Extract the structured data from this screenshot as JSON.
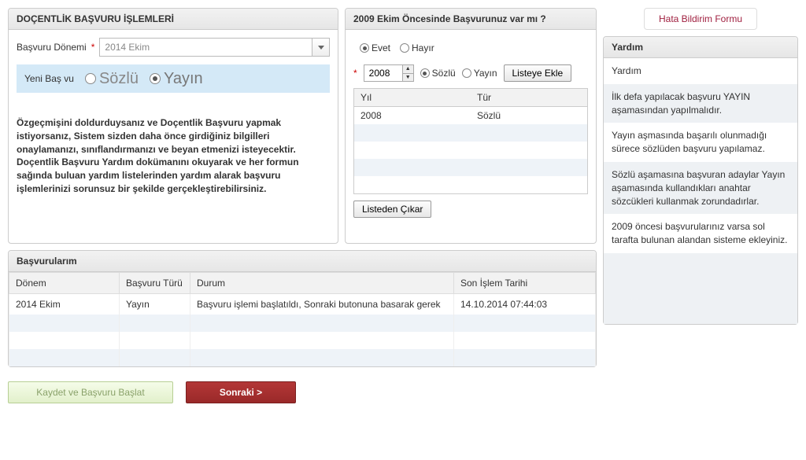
{
  "left_panel": {
    "title": "DOÇENTLİK BAŞVURU İŞLEMLERİ",
    "period_label": "Başvuru Dönemi",
    "period_value": "2014 Ekim",
    "new_app_label": "Yeni Baş vu",
    "radio_sozlu": "Sözlü",
    "radio_yayin": "Yayın",
    "info": "Özgeçmişini doldurduysanız ve Doçentlik Başvuru yapmak istiyorsanız, Sistem sizden daha önce girdiğiniz bilgilleri onaylamanızı, sınıflandırmanızı ve beyan etmenizi isteyecektir. Doçentlik Başvuru Yardım dokümanını okuyarak ve her formun sağında buluan yardım listelerinden yardım alarak başvuru işlemlerinizi sorunsuz bir şekilde gerçekleştirebilirsiniz."
  },
  "mid_panel": {
    "title": "2009 Ekim Öncesinde Başvurunuz var mı ?",
    "opt_yes": "Evet",
    "opt_no": "Hayır",
    "year_value": "2008",
    "opt_sozlu": "Sözlü",
    "opt_yayin": "Yayın",
    "btn_add": "Listeye Ekle",
    "col_year": "Yıl",
    "col_type": "Tür",
    "rows": [
      {
        "year": "2008",
        "type": "Sözlü"
      }
    ],
    "btn_remove": "Listeden Çıkar"
  },
  "apps_panel": {
    "title": "Başvurularım",
    "col_period": "Dönem",
    "col_type": "Başvuru Türü",
    "col_status": "Durum",
    "col_date": "Son İşlem Tarihi",
    "rows": [
      {
        "period": "2014 Ekim",
        "type": "Yayın",
        "status": "Başvuru işlemi başlatıldı, Sonraki butonuna basarak gerek",
        "date": "14.10.2014 07:44:03"
      }
    ]
  },
  "actions": {
    "save": "Kaydet ve Başvuru Başlat",
    "next": "Sonraki >"
  },
  "right": {
    "report_btn": "Hata Bildirim Formu",
    "help_title": "Yardım",
    "help_items": [
      "Yardım",
      "İlk defa yapılacak başvuru YAYIN aşamasından yapılmalıdır.",
      "Yayın aşmasında başarılı olunmadığı sürece sözlüden başvuru yapılamaz.",
      "Sözlü aşamasına başvuran adaylar Yayın aşamasında kullandıkları anahtar sözcükleri kullanmak zorundadırlar.",
      "2009 öncesi başvurularınız varsa sol tarafta bulunan alandan sisteme ekleyiniz."
    ]
  }
}
